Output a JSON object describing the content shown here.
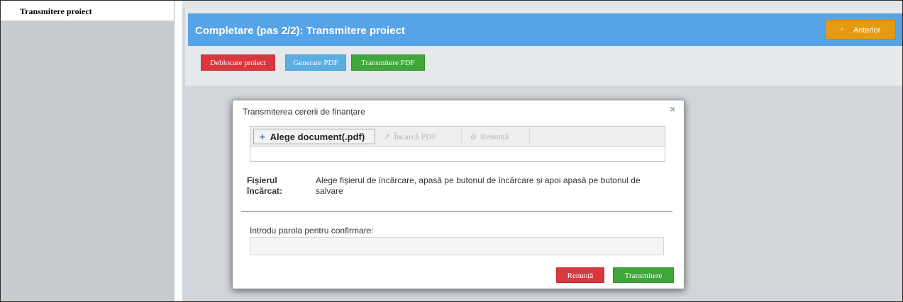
{
  "sidebar": {
    "active_item": "Transmitere proiect"
  },
  "panel": {
    "title": "Completare (pas 2/2): Transmitere proiect",
    "prev_button": "Anterior",
    "actions": [
      "Deblocare proiect",
      "Generare PDF",
      "Transmitere PDF"
    ]
  },
  "modal": {
    "title": "Transmiterea cererii de finanțare",
    "close": "×",
    "uploader": {
      "choose": "Alege document(.pdf)",
      "upload": "Încarcă PDF",
      "cancel": "Renunță"
    },
    "file_label": "Fișierul încărcat:",
    "file_help": "Alege fișierul de încărcare, apasă pe butonul de încărcare și apoi apasă pe butonul de salvare",
    "password_label": "Introdu parola pentru confirmare:",
    "password_value": "",
    "buttons": {
      "cancel": "Renunță",
      "submit": "Transmitere"
    }
  },
  "colors": {
    "header_blue": "#56a3e8",
    "prev_orange": "#e49a12",
    "danger_red": "#d9393e",
    "info_blue": "#5aaee2",
    "success_green": "#3ea63a"
  }
}
